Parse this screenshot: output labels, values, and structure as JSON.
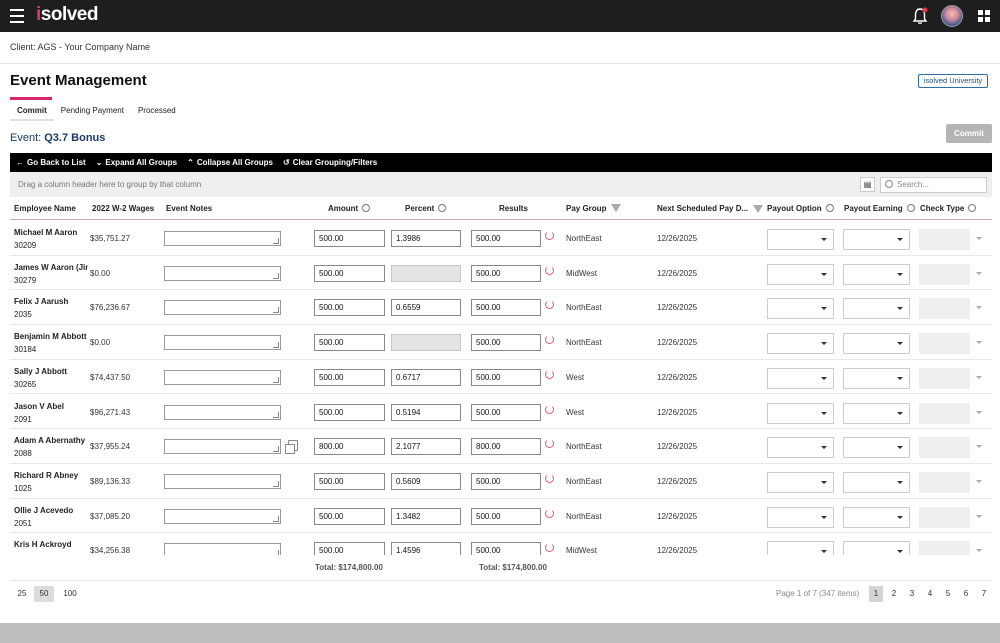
{
  "app": {
    "logo": "isolved",
    "logo_dot": "i"
  },
  "client_label": "Client: AGS - Your Company Name",
  "page_title": "Event Management",
  "university_button": "isolved University",
  "tabs": [
    {
      "label": "Commit"
    },
    {
      "label": "Pending Payment"
    },
    {
      "label": "Processed"
    }
  ],
  "event": {
    "prefix": "Event:",
    "name": "Q3.7 Bonus"
  },
  "commit_button": "Commit",
  "toolbar": {
    "back": "Go Back to List",
    "expand": "Expand All Groups",
    "collapse": "Collapse All Groups",
    "clear": "Clear Grouping/Filters"
  },
  "group_hint": "Drag a column header here to group by that column",
  "search": {
    "placeholder": "Search..."
  },
  "columns": {
    "employee_name": "Employee Name",
    "wages": "2022 W-2 Wages",
    "event_notes": "Event Notes",
    "amount": "Amount",
    "percent": "Percent",
    "results": "Results",
    "pay_group": "Pay Group",
    "next_pay": "Next Scheduled Pay D...",
    "payout_option": "Payout Option",
    "payout_earning": "Payout Earning",
    "check_type": "Check Type"
  },
  "rows": [
    {
      "name": "Michael M Aaron",
      "id": "30209",
      "wages": "$35,751.27",
      "amount": "500.00",
      "percent": "1.3986",
      "results": "500.00",
      "pay_group": "NorthEast",
      "next_pay": "12/26/2025"
    },
    {
      "name": "James W Aaron (Jim)",
      "id": "30279",
      "wages": "$0.00",
      "amount": "500.00",
      "percent": "",
      "results": "500.00",
      "pay_group": "MidWest",
      "next_pay": "12/26/2025"
    },
    {
      "name": "Felix J Aarush",
      "id": "2035",
      "wages": "$76,236.67",
      "amount": "500.00",
      "percent": "0.6559",
      "results": "500.00",
      "pay_group": "NorthEast",
      "next_pay": "12/26/2025"
    },
    {
      "name": "Benjamin M Abbott",
      "id": "30184",
      "wages": "$0.00",
      "amount": "500.00",
      "percent": "",
      "results": "500.00",
      "pay_group": "NorthEast",
      "next_pay": "12/26/2025"
    },
    {
      "name": "Sally J Abbott",
      "id": "30265",
      "wages": "$74,437.50",
      "amount": "500.00",
      "percent": "0.6717",
      "results": "500.00",
      "pay_group": "West",
      "next_pay": "12/26/2025"
    },
    {
      "name": "Jason V Abel",
      "id": "2091",
      "wages": "$96,271.43",
      "amount": "500.00",
      "percent": "0.5194",
      "results": "500.00",
      "pay_group": "West",
      "next_pay": "12/26/2025"
    },
    {
      "name": "Adam A Abernathy",
      "id": "2088",
      "wages": "$37,955.24",
      "amount": "800.00",
      "percent": "2.1077",
      "results": "800.00",
      "pay_group": "NorthEast",
      "next_pay": "12/26/2025"
    },
    {
      "name": "Richard R Abney",
      "id": "1025",
      "wages": "$89,136.33",
      "amount": "500.00",
      "percent": "0.5609",
      "results": "500.00",
      "pay_group": "NorthEast",
      "next_pay": "12/26/2025"
    },
    {
      "name": "Ollie J Acevedo",
      "id": "2051",
      "wages": "$37,085.20",
      "amount": "500.00",
      "percent": "1.3482",
      "results": "500.00",
      "pay_group": "NorthEast",
      "next_pay": "12/26/2025"
    },
    {
      "name": "Kris H Ackroyd",
      "id": "",
      "wages": "$34,256.38",
      "amount": "500.00",
      "percent": "1.4596",
      "results": "500.00",
      "pay_group": "MidWest",
      "next_pay": "12/26/2025"
    }
  ],
  "totals": {
    "amount": "Total: $174,800.00",
    "results": "Total: $174,800.00"
  },
  "pager": {
    "sizes": [
      "25",
      "50",
      "100"
    ],
    "info": "Page 1 of 7 (347 items)",
    "pages": [
      "1",
      "2",
      "3",
      "4",
      "5",
      "6",
      "7"
    ]
  }
}
